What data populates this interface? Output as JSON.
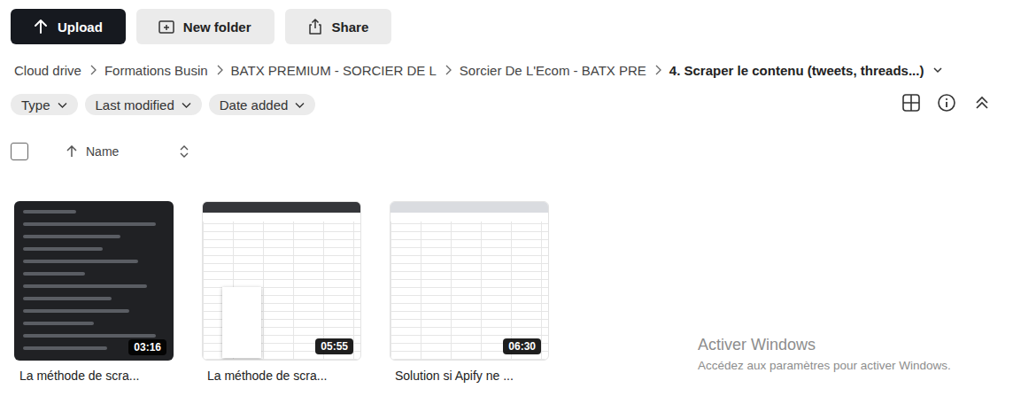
{
  "toolbar": {
    "buttons": [
      {
        "label": "Upload",
        "kind": "primary"
      },
      {
        "label": "New folder",
        "kind": "folder"
      },
      {
        "label": "Share",
        "kind": "share"
      }
    ]
  },
  "breadcrumb": [
    "Cloud drive",
    "Formations Busin",
    "BATX PREMIUM - SORCIER DE L",
    "Sorcier De L'Ecom - BATX PRE",
    "4. Scraper le contenu (tweets, threads...)"
  ],
  "filters": [
    "Type",
    "Last modified",
    "Date added"
  ],
  "list_header": {
    "select_all_checked": false,
    "sort_column": "Name"
  },
  "files": [
    {
      "name": "La méthode de scra...",
      "duration": "03:16",
      "kind": "dark"
    },
    {
      "name": "La méthode de scra...",
      "duration": "05:55",
      "kind": "sheet"
    },
    {
      "name": "Solution si Apify ne ...",
      "duration": "06:30",
      "kind": "blank"
    }
  ],
  "watermark": {
    "title": "Activer Windows",
    "subtitle": "Accédez aux paramètres pour activer Windows."
  }
}
